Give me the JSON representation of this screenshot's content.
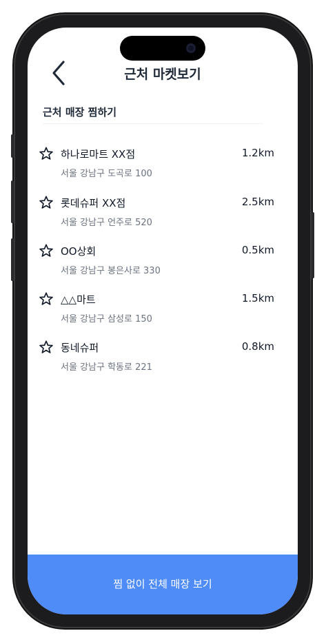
{
  "header": {
    "title": "근처 마켓보기"
  },
  "section": {
    "title": "근처 매장 찜하기"
  },
  "stores": [
    {
      "name": "하나로마트 XX점",
      "address": "서울 강남구 도곡로 100",
      "distance": "1.2km",
      "favorited": false
    },
    {
      "name": "롯데슈퍼 XX점",
      "address": "서울 강남구 언주로 520",
      "distance": "2.5km",
      "favorited": false
    },
    {
      "name": "OO상회",
      "address": "서울 강남구 봉은사로 330",
      "distance": "0.5km",
      "favorited": false
    },
    {
      "name": "△△마트",
      "address": "서울 강남구 삼성로 150",
      "distance": "1.5km",
      "favorited": false
    },
    {
      "name": "동네슈퍼",
      "address": "서울 강남구 학동로 221",
      "distance": "0.8km",
      "favorited": false
    }
  ],
  "cta": {
    "label": "찜 없이 전체 매장 보기"
  },
  "colors": {
    "accent": "#4f8cf7",
    "text_primary": "#111827",
    "text_secondary": "#6b7280"
  },
  "icons": {
    "back": "chevron-left-icon",
    "favorite": "star-outline-icon"
  }
}
